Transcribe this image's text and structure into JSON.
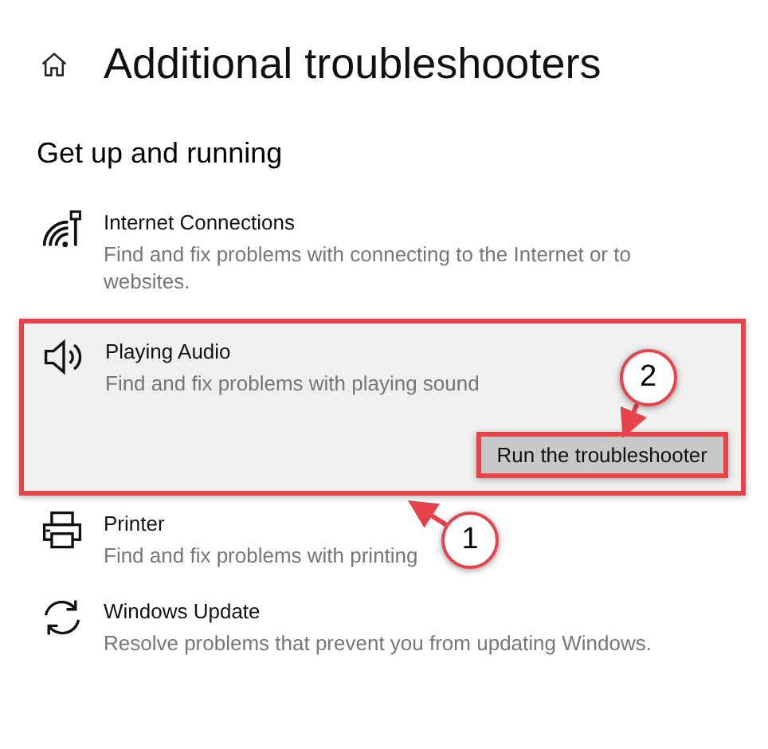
{
  "page": {
    "title": "Additional troubleshooters",
    "section": "Get up and running"
  },
  "items": [
    {
      "title": "Internet Connections",
      "description": "Find and fix problems with connecting to the Internet or to websites.",
      "selected": false
    },
    {
      "title": "Playing Audio",
      "description": "Find and fix problems with playing sound",
      "selected": true,
      "button": "Run the troubleshooter"
    },
    {
      "title": "Printer",
      "description": "Find and fix problems with printing",
      "selected": false
    },
    {
      "title": "Windows Update",
      "description": "Resolve problems that prevent you from updating Windows.",
      "selected": false
    }
  ],
  "callouts": [
    {
      "label": "1"
    },
    {
      "label": "2"
    }
  ]
}
